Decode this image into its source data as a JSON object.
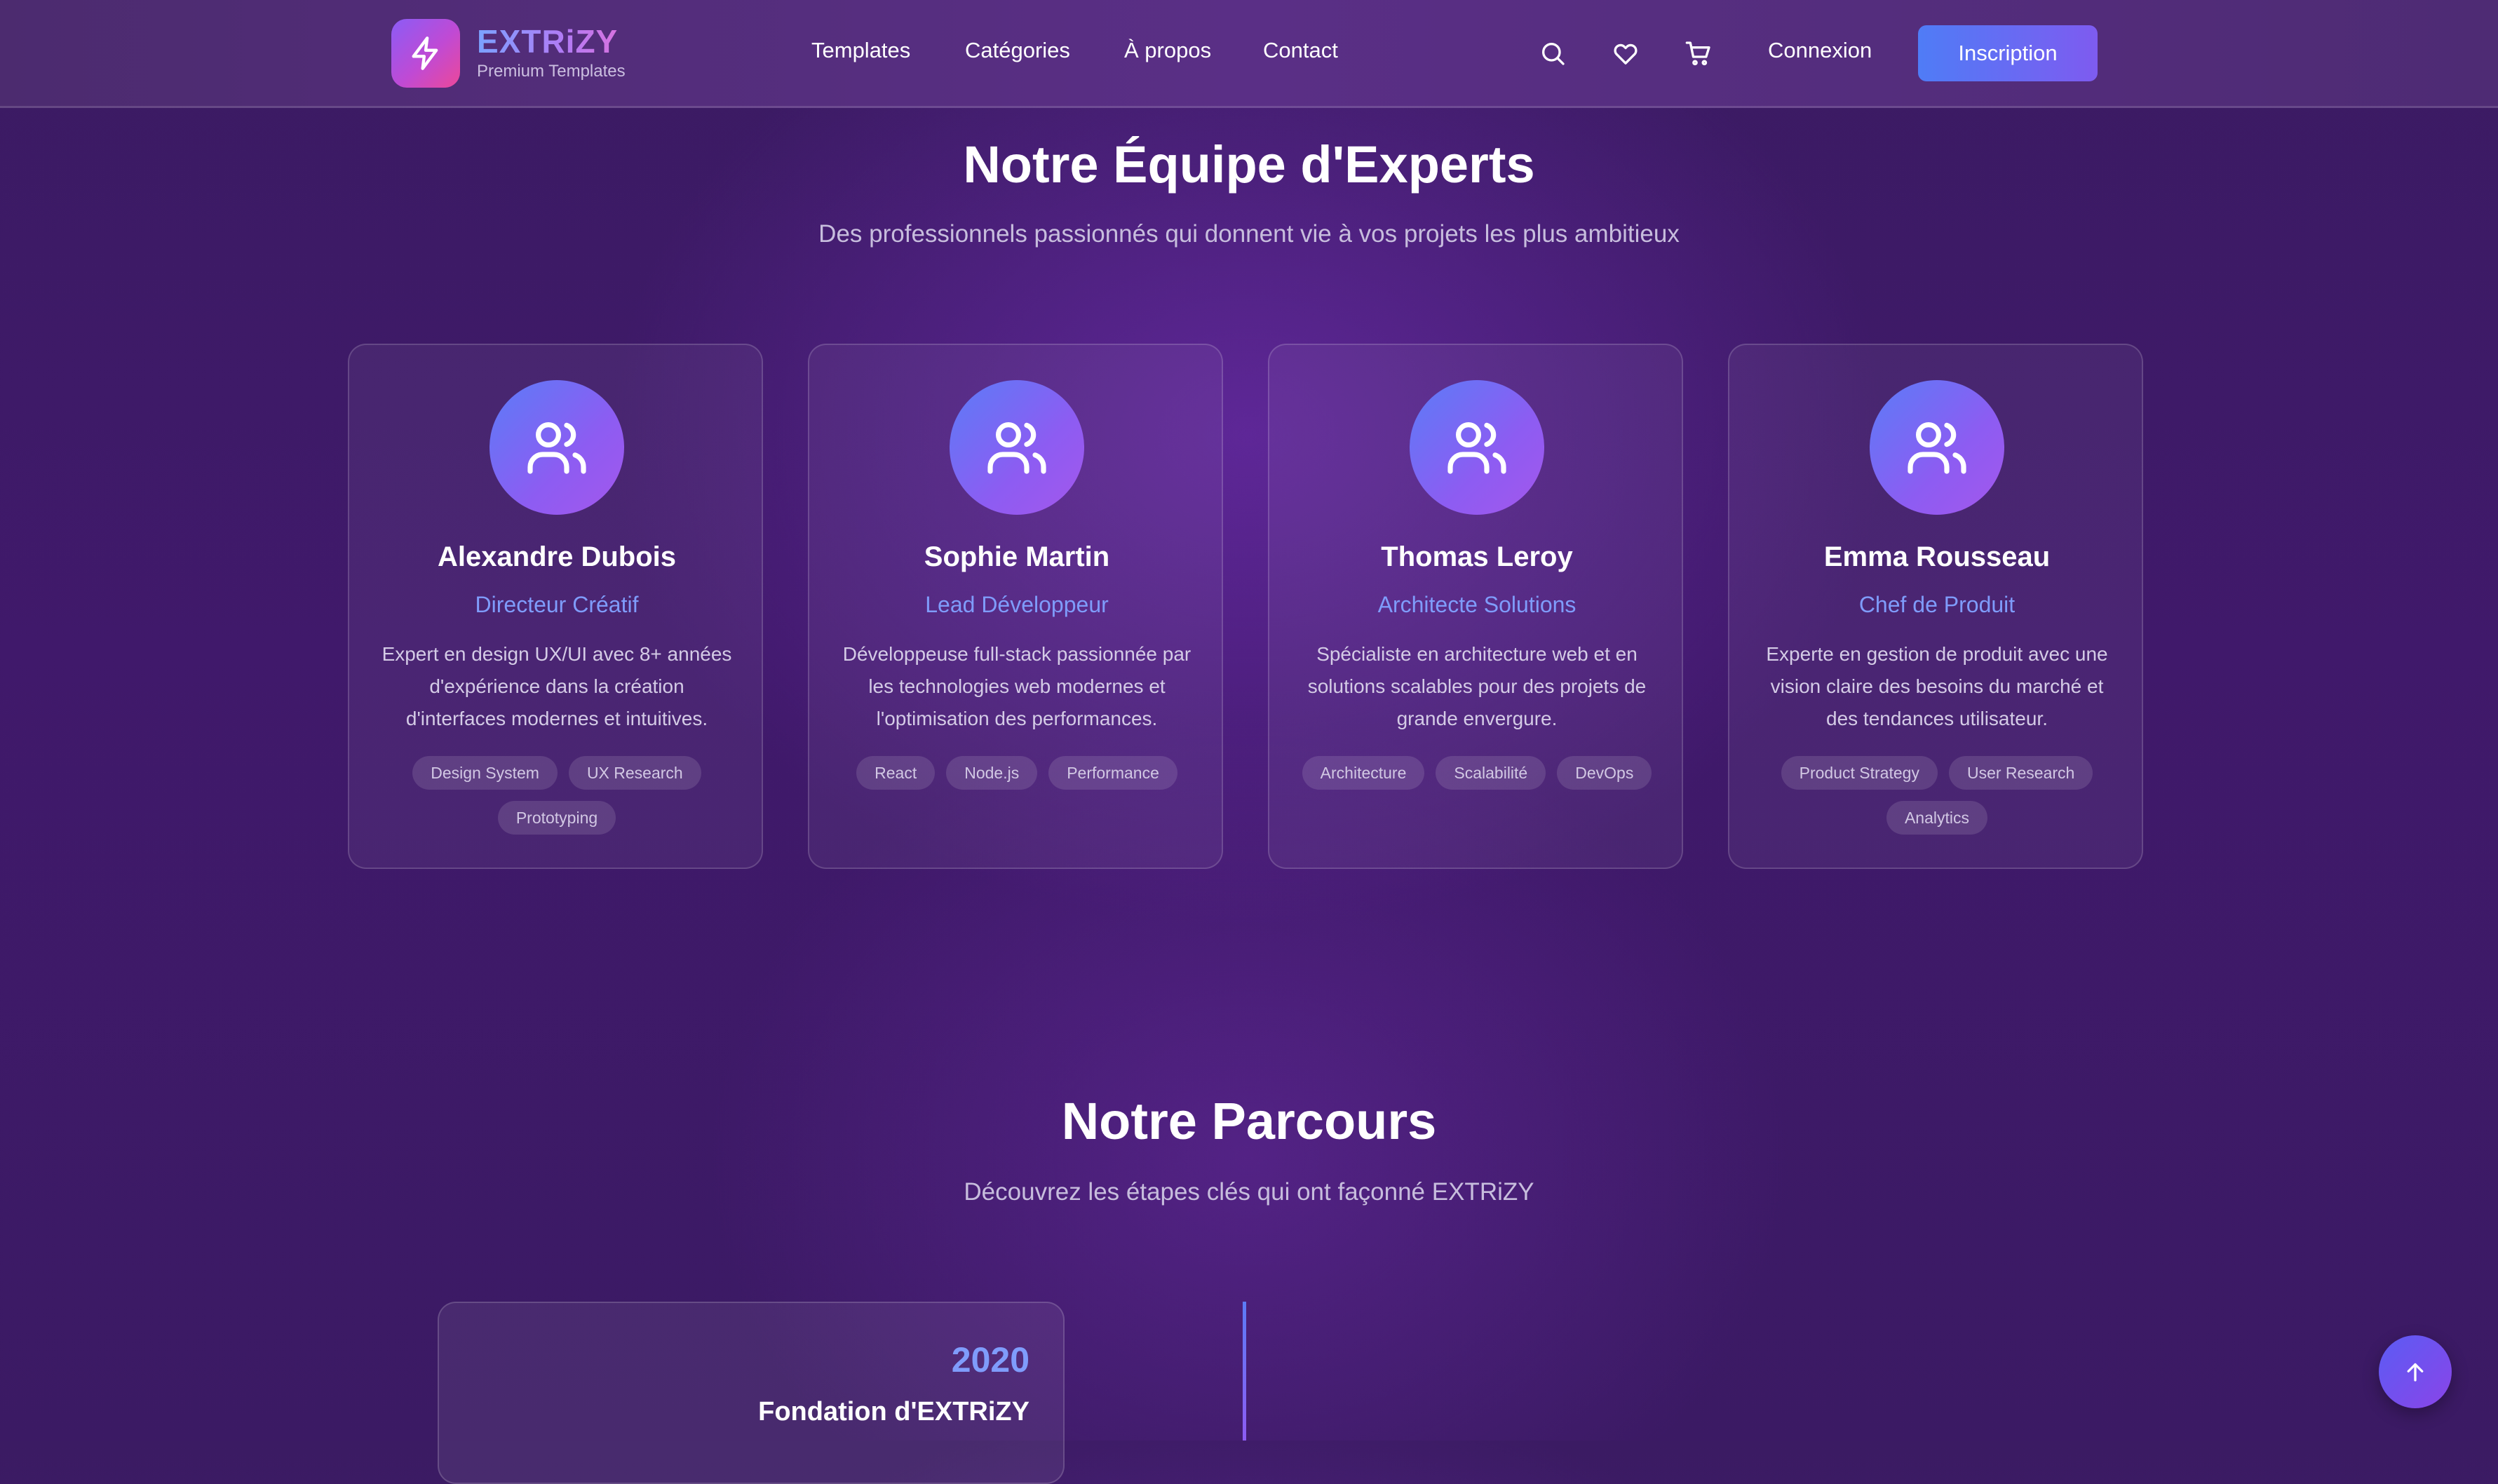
{
  "brand": {
    "name": "EXTRiZY",
    "tagline": "Premium Templates",
    "logo_icon": "lightning-bolt-icon"
  },
  "nav": {
    "links": [
      "Templates",
      "Catégories",
      "À propos",
      "Contact"
    ],
    "icons": [
      "search-icon",
      "heart-icon",
      "cart-icon"
    ],
    "login_label": "Connexion",
    "signup_label": "Inscription"
  },
  "team_section": {
    "title": "Notre Équipe d'Experts",
    "subtitle": "Des professionnels passionnés qui donnent vie à vos projets les plus ambitieux",
    "members": [
      {
        "name": "Alexandre Dubois",
        "role": "Directeur Créatif",
        "bio": "Expert en design UX/UI avec 8+ années d'expérience dans la création d'interfaces modernes et intuitives.",
        "tags": [
          "Design System",
          "UX Research",
          "Prototyping"
        ]
      },
      {
        "name": "Sophie Martin",
        "role": "Lead Développeur",
        "bio": "Développeuse full-stack passionnée par les technologies web modernes et l'optimisation des performances.",
        "tags": [
          "React",
          "Node.js",
          "Performance"
        ]
      },
      {
        "name": "Thomas Leroy",
        "role": "Architecte Solutions",
        "bio": "Spécialiste en architecture web et en solutions scalables pour des projets de grande envergure.",
        "tags": [
          "Architecture",
          "Scalabilité",
          "DevOps"
        ]
      },
      {
        "name": "Emma Rousseau",
        "role": "Chef de Produit",
        "bio": "Experte en gestion de produit avec une vision claire des besoins du marché et des tendances utilisateur.",
        "tags": [
          "Product Strategy",
          "User Research",
          "Analytics"
        ]
      }
    ]
  },
  "journey_section": {
    "title": "Notre Parcours",
    "subtitle": "Découvrez les étapes clés qui ont façonné EXTRiZY",
    "milestones": [
      {
        "year": "2020",
        "title": "Fondation d'EXTRiZY"
      }
    ]
  },
  "colors": {
    "accent_blue": "#7f9cfb",
    "button_gradient_start": "#4f7cf6",
    "button_gradient_end": "#7e5bf0",
    "background": "#40196b"
  }
}
